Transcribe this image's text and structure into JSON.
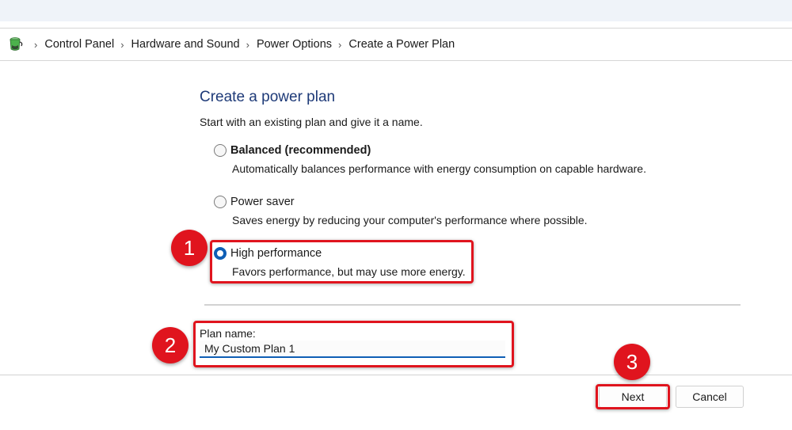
{
  "breadcrumb": {
    "icon": "power-options-icon",
    "items": [
      {
        "label": "Control Panel"
      },
      {
        "label": "Hardware and Sound"
      },
      {
        "label": "Power Options"
      },
      {
        "label": "Create a Power Plan"
      }
    ],
    "separator": "›"
  },
  "main": {
    "title": "Create a power plan",
    "subtitle": "Start with an existing plan and give it a name.",
    "options": [
      {
        "label": "Balanced (recommended)",
        "description": "Automatically balances performance with energy consumption on capable hardware.",
        "selected": false,
        "bold": true
      },
      {
        "label": "Power saver",
        "description": "Saves energy by reducing your computer's performance where possible.",
        "selected": false,
        "bold": false
      },
      {
        "label": "High performance",
        "description": "Favors performance, but may use more energy.",
        "selected": true,
        "bold": false
      }
    ],
    "plan_name": {
      "label": "Plan name:",
      "value": "My Custom Plan 1"
    }
  },
  "footer": {
    "next_label": "Next",
    "cancel_label": "Cancel"
  },
  "annotations": {
    "accent_color": "#e0141e",
    "steps": [
      "1",
      "2",
      "3"
    ]
  },
  "colors": {
    "title": "#1e3a78",
    "radio_selected": "#0f5fb5"
  }
}
